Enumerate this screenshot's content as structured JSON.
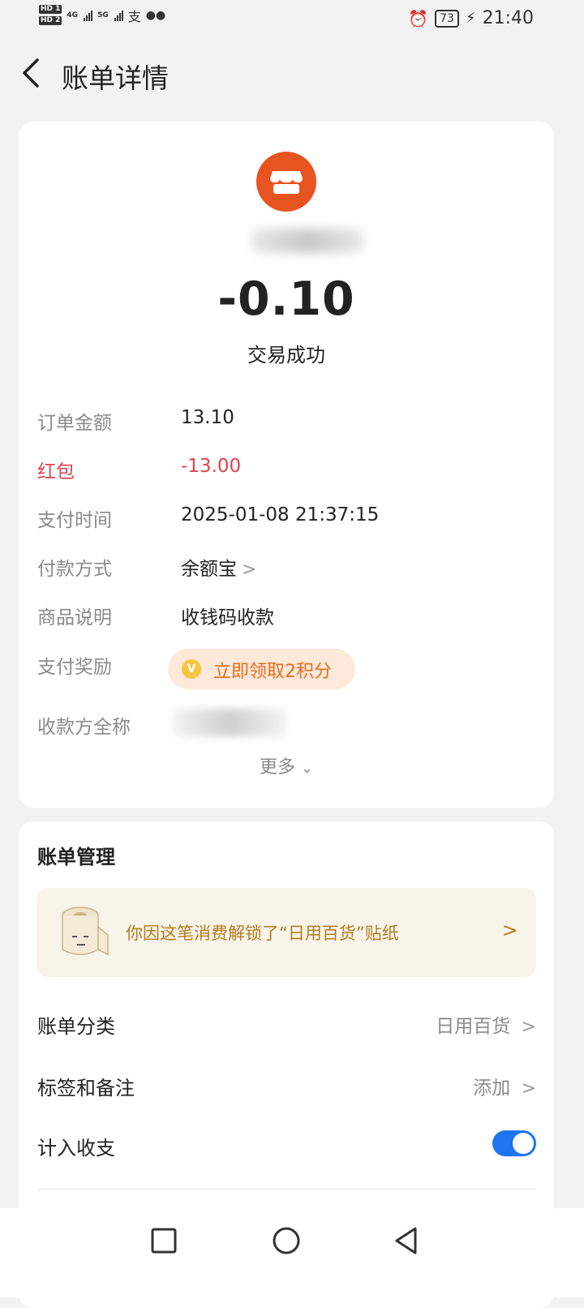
{
  "status_bar": {
    "time": "21:40",
    "battery": "73",
    "network_1": "4G",
    "network_2": "5G"
  },
  "header": {
    "title": "账单详情"
  },
  "summary": {
    "amount": "-0.10",
    "status": "交易成功"
  },
  "details": {
    "order_amount": {
      "label": "订单金额",
      "value": "13.10"
    },
    "red_packet": {
      "label": "红包",
      "value": "-13.00"
    },
    "pay_time": {
      "label": "支付时间",
      "value": "2025-01-08 21:37:15"
    },
    "pay_method": {
      "label": "付款方式",
      "value": "余额宝"
    },
    "product_desc": {
      "label": "商品说明",
      "value": "收钱码收款"
    },
    "reward": {
      "label": "支付奖励",
      "value": "立即领取2积分"
    },
    "payee": {
      "label": "收款方全称"
    },
    "more": "更多"
  },
  "manage": {
    "title": "账单管理",
    "sticker_text": "你因这笔消费解锁了“日用百货”贴纸",
    "category": {
      "label": "账单分类",
      "value": "日用百货"
    },
    "tags": {
      "label": "标签和备注",
      "value": "添加"
    },
    "include": {
      "label": "计入收支",
      "enabled": true
    }
  },
  "colors": {
    "accent_blue": "#1f75f0",
    "red": "#e0424f",
    "merchant_orange": "#e8541f",
    "reward_orange": "#e66b1f",
    "sticker_gold": "#b27c1f"
  }
}
